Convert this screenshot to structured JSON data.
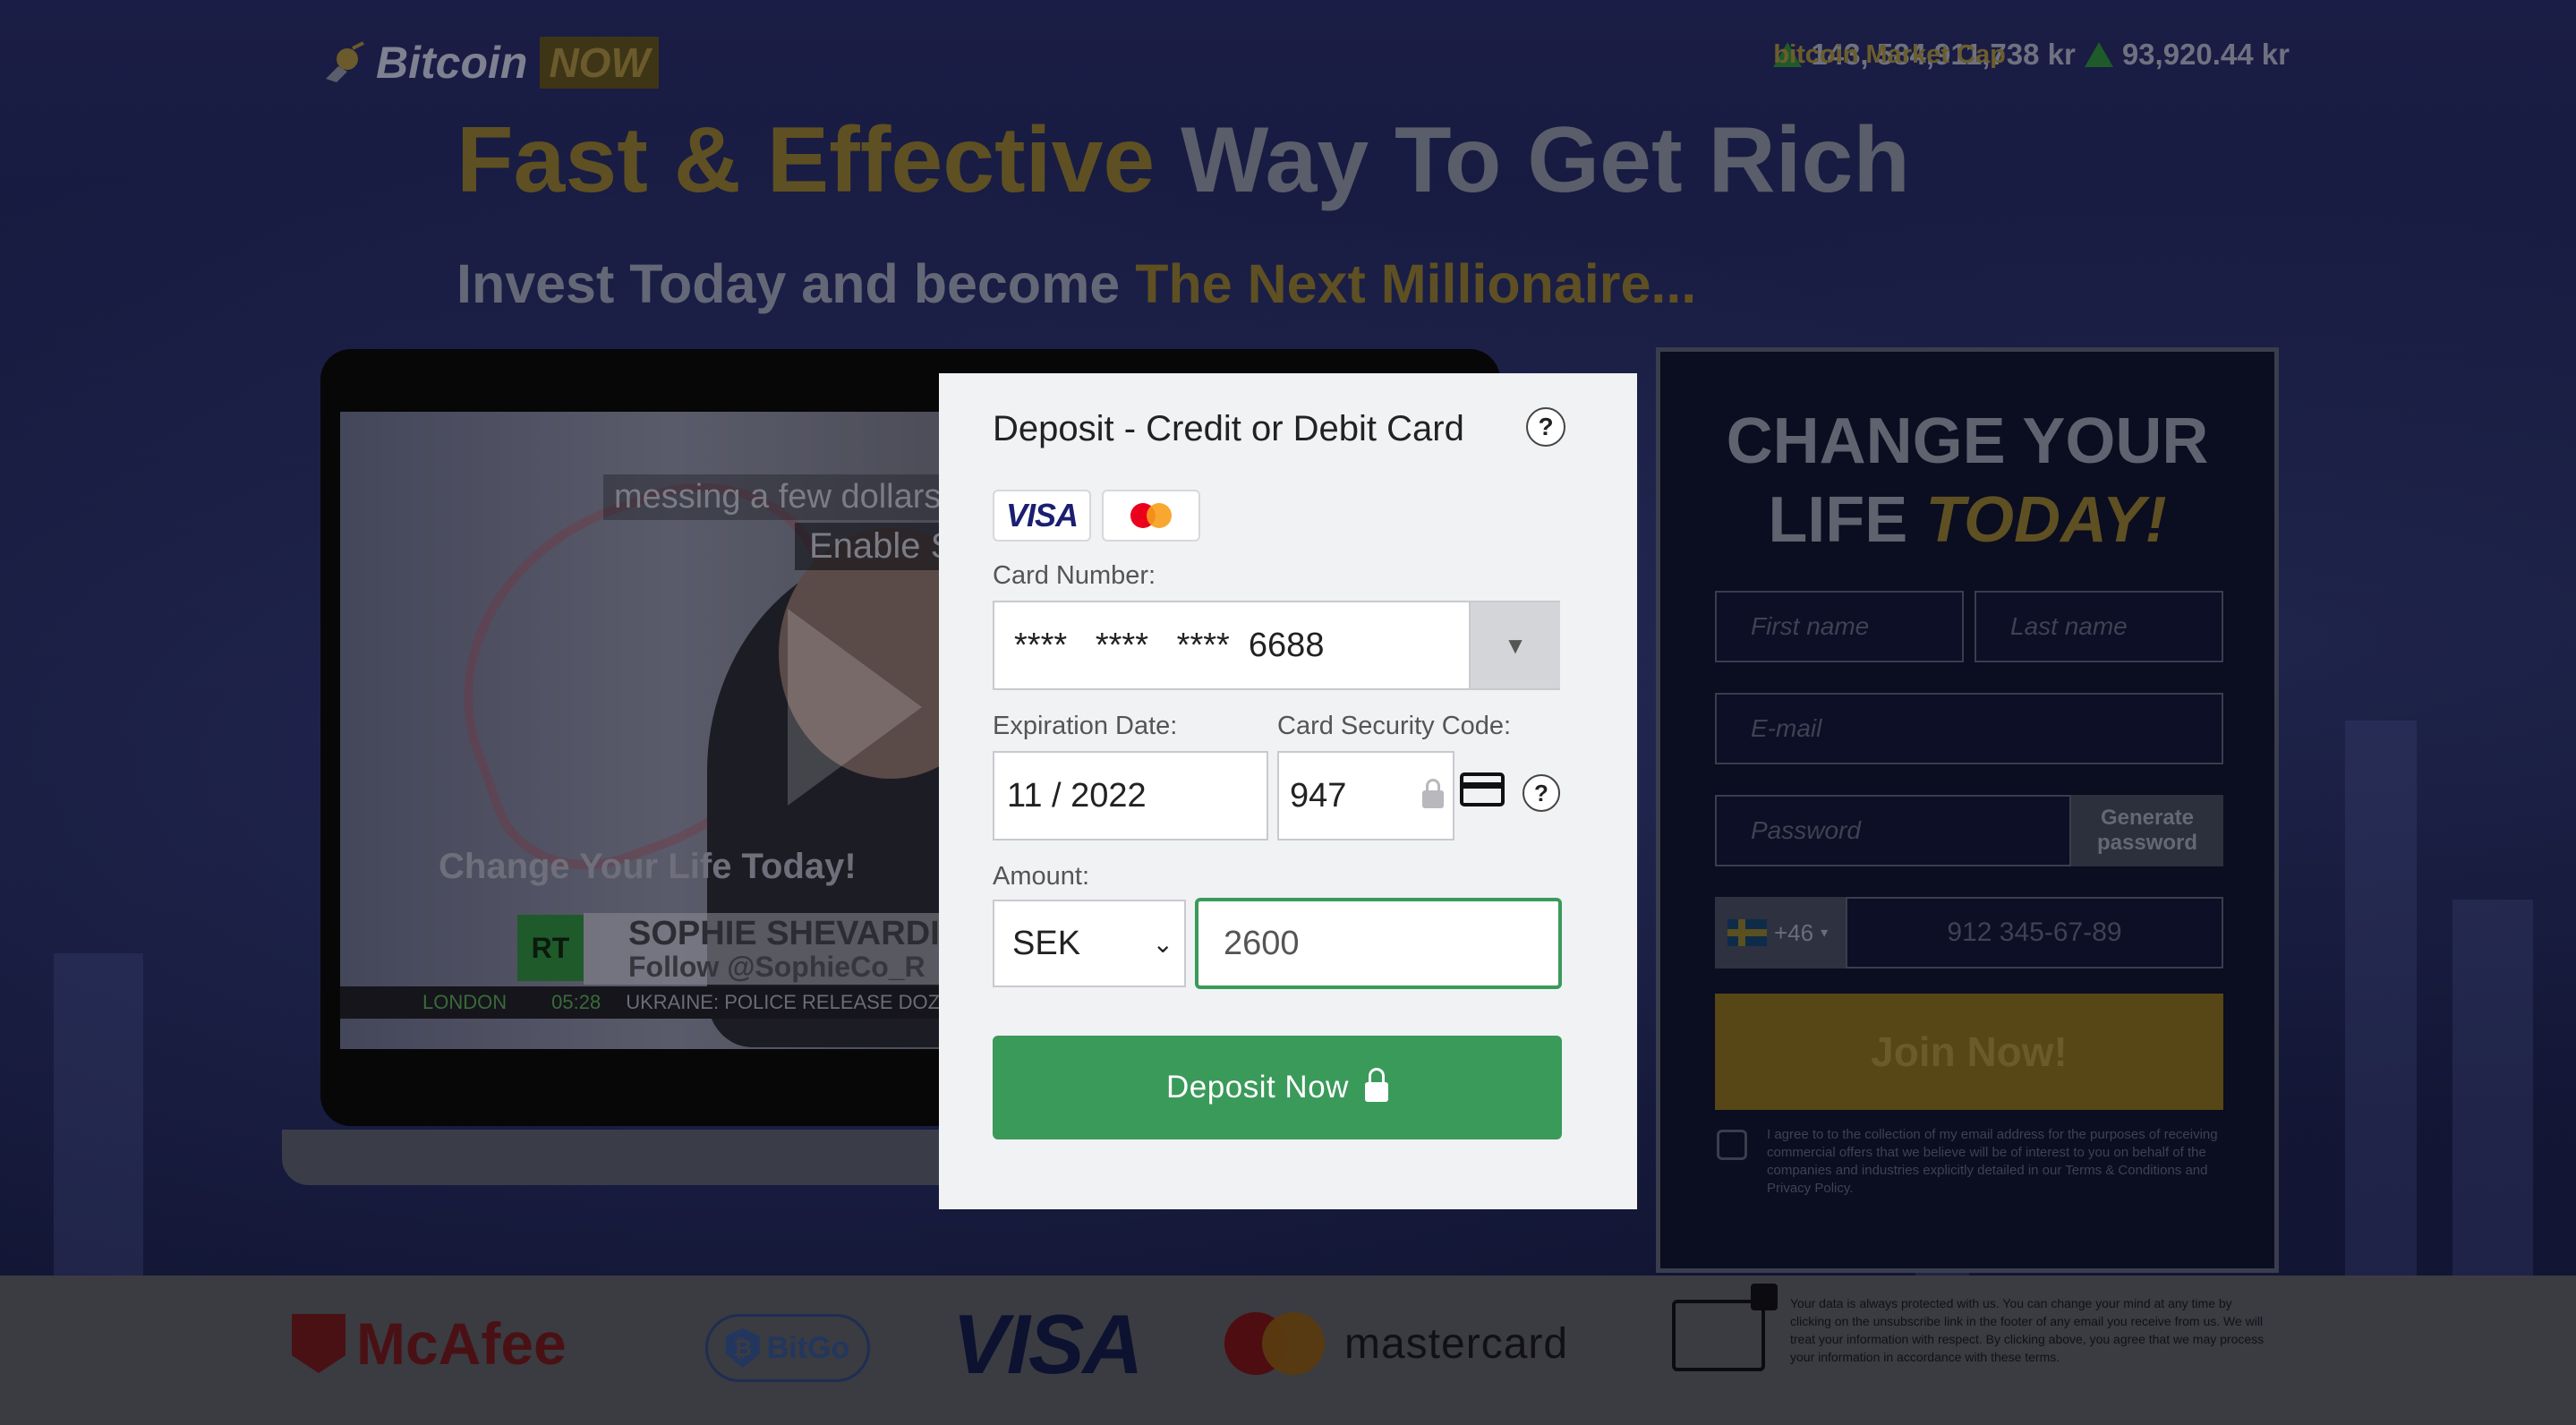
{
  "header": {
    "logo_word": "Bitcoin",
    "logo_badge": "NOW",
    "ticker": {
      "cap_label": "bitcoin Market Cap",
      "cap_value": "143, 584,911,738 kr",
      "price_label": "bitcoin",
      "price_value": "93,920.44 kr"
    }
  },
  "hero": {
    "headline_gold": "Fast & Effective",
    "headline_grey": "Way To Get Rich",
    "subhead_grey": "Invest Today and become",
    "subhead_gold": "The Next Millionaire..."
  },
  "video": {
    "caption_line1": "messing a few dollars",
    "caption_line2": "Enable S",
    "overlay_text": "Change Your Life Today!",
    "channel_logo": "RT",
    "lower_third_name": "SOPHIE SHEVARDI",
    "lower_third_handle": "Follow @SophieCo_R",
    "ticker_location": "LONDON",
    "ticker_time": "05:28",
    "ticker_news": "UKRAINE: POLICE RELEASE DOZENS O"
  },
  "signup": {
    "title_line1": "CHANGE YOUR",
    "title_line2_plain": "LIFE",
    "title_line2_accent": "TODAY!",
    "first_name_placeholder": "First name",
    "last_name_placeholder": "Last name",
    "email_placeholder": "E-mail",
    "password_placeholder": "Password",
    "generate_password_label": "Generate password",
    "phone_prefix": "+46",
    "phone_placeholder": "912 345-67-89",
    "join_label": "Join Now!",
    "agree_text": "I agree to to the collection of my email address for the purposes of receiving commercial offers that we believe will be of interest to you on behalf of the companies and industries explicitly detailed in our Terms & Conditions and Privacy Policy."
  },
  "footer": {
    "mcafee": "McAfee",
    "bitgo": "BitGo",
    "visa": "VISA",
    "mastercard": "mastercard",
    "privacy_text": "Your data is always protected with us. You can change your mind at any time by clicking on the unsubscribe link in the footer of any email you receive from us. We will treat your information with respect. By clicking above, you agree that we may process your information in accordance with these terms."
  },
  "modal": {
    "title": "Deposit - Credit or Debit Card",
    "help_glyph": "?",
    "visa_label": "VISA",
    "card_number_label": "Card Number:",
    "card_number_value": "****   ****   ****  6688",
    "expiration_label": "Expiration Date:",
    "expiration_value": "11 / 2022",
    "security_label": "Card Security Code:",
    "security_value": "947",
    "amount_label": "Amount:",
    "currency_value": "SEK",
    "amount_value": "2600",
    "deposit_label": "Deposit Now"
  },
  "colors": {
    "deposit_button": "#3a9a5a",
    "amount_focus_border": "#3a9a5a",
    "gold_accent": "#5e5022"
  }
}
